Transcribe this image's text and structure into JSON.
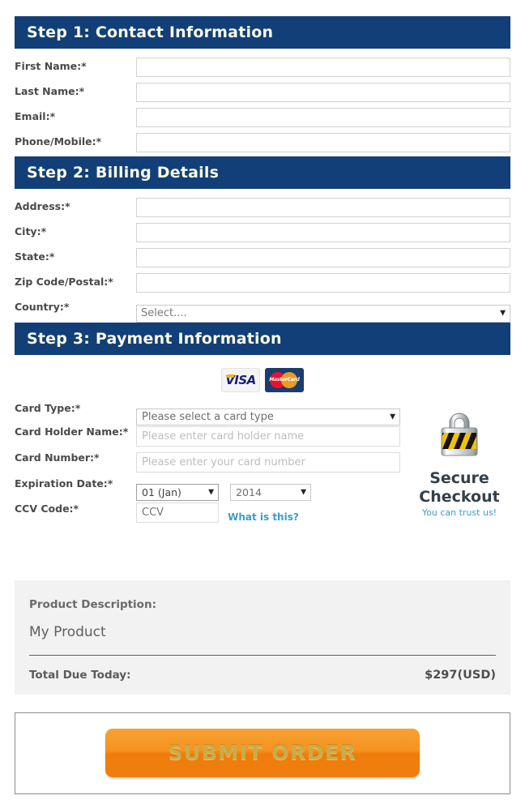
{
  "step1": {
    "header": "Step 1: Contact Information",
    "fields": [
      {
        "label": "First Name:*",
        "value": "",
        "placeholder": ""
      },
      {
        "label": "Last Name:*",
        "value": "",
        "placeholder": ""
      },
      {
        "label": "Email:*",
        "value": "",
        "placeholder": ""
      },
      {
        "label": "Phone/Mobile:*",
        "value": "",
        "placeholder": ""
      }
    ]
  },
  "step2": {
    "header": "Step 2: Billing Details",
    "fields": [
      {
        "label": "Address:*",
        "value": "",
        "placeholder": ""
      },
      {
        "label": "City:*",
        "value": "",
        "placeholder": ""
      },
      {
        "label": "State:*",
        "value": "",
        "placeholder": ""
      },
      {
        "label": "Zip Code/Postal:*",
        "value": "",
        "placeholder": ""
      }
    ],
    "country_label": "Country:*",
    "country_value": "Select...."
  },
  "step3": {
    "header": "Step 3: Payment Information",
    "card_logos": [
      {
        "name": "visa-logo",
        "text": "VISA"
      },
      {
        "name": "mastercard-logo",
        "text": "MasterCard"
      }
    ],
    "card_type_label": "Card Type:*",
    "card_type_value": "Please select a card type",
    "card_holder_label": "Card Holder Name:*",
    "card_holder_placeholder": "Please enter card holder name",
    "card_number_label": "Card Number:*",
    "card_number_placeholder": "Please enter your card number",
    "expiration_label": "Expiration Date:*",
    "expiration_month": "01 (Jan)",
    "expiration_year": "2014",
    "ccv_label": "CCV Code:*",
    "ccv_placeholder": "CCV",
    "what_is_this": "What is this?",
    "secure": {
      "title_line1": "Secure",
      "title_line2": "Checkout",
      "subtitle": "You can trust us!"
    }
  },
  "summary": {
    "product_label": "Product Description:",
    "product_name": "My Product",
    "total_label": "Total Due Today:",
    "total_value": "$297(USD)"
  },
  "submit": {
    "label": "SUBMIT ORDER"
  },
  "colors": {
    "header_blue": "#123f77",
    "header_text": "#fbfbe8",
    "link_teal": "#3b9dc2",
    "summary_bg": "#f2f2f2",
    "button_orange": "#f59320",
    "button_text": "#c6ae4a"
  }
}
